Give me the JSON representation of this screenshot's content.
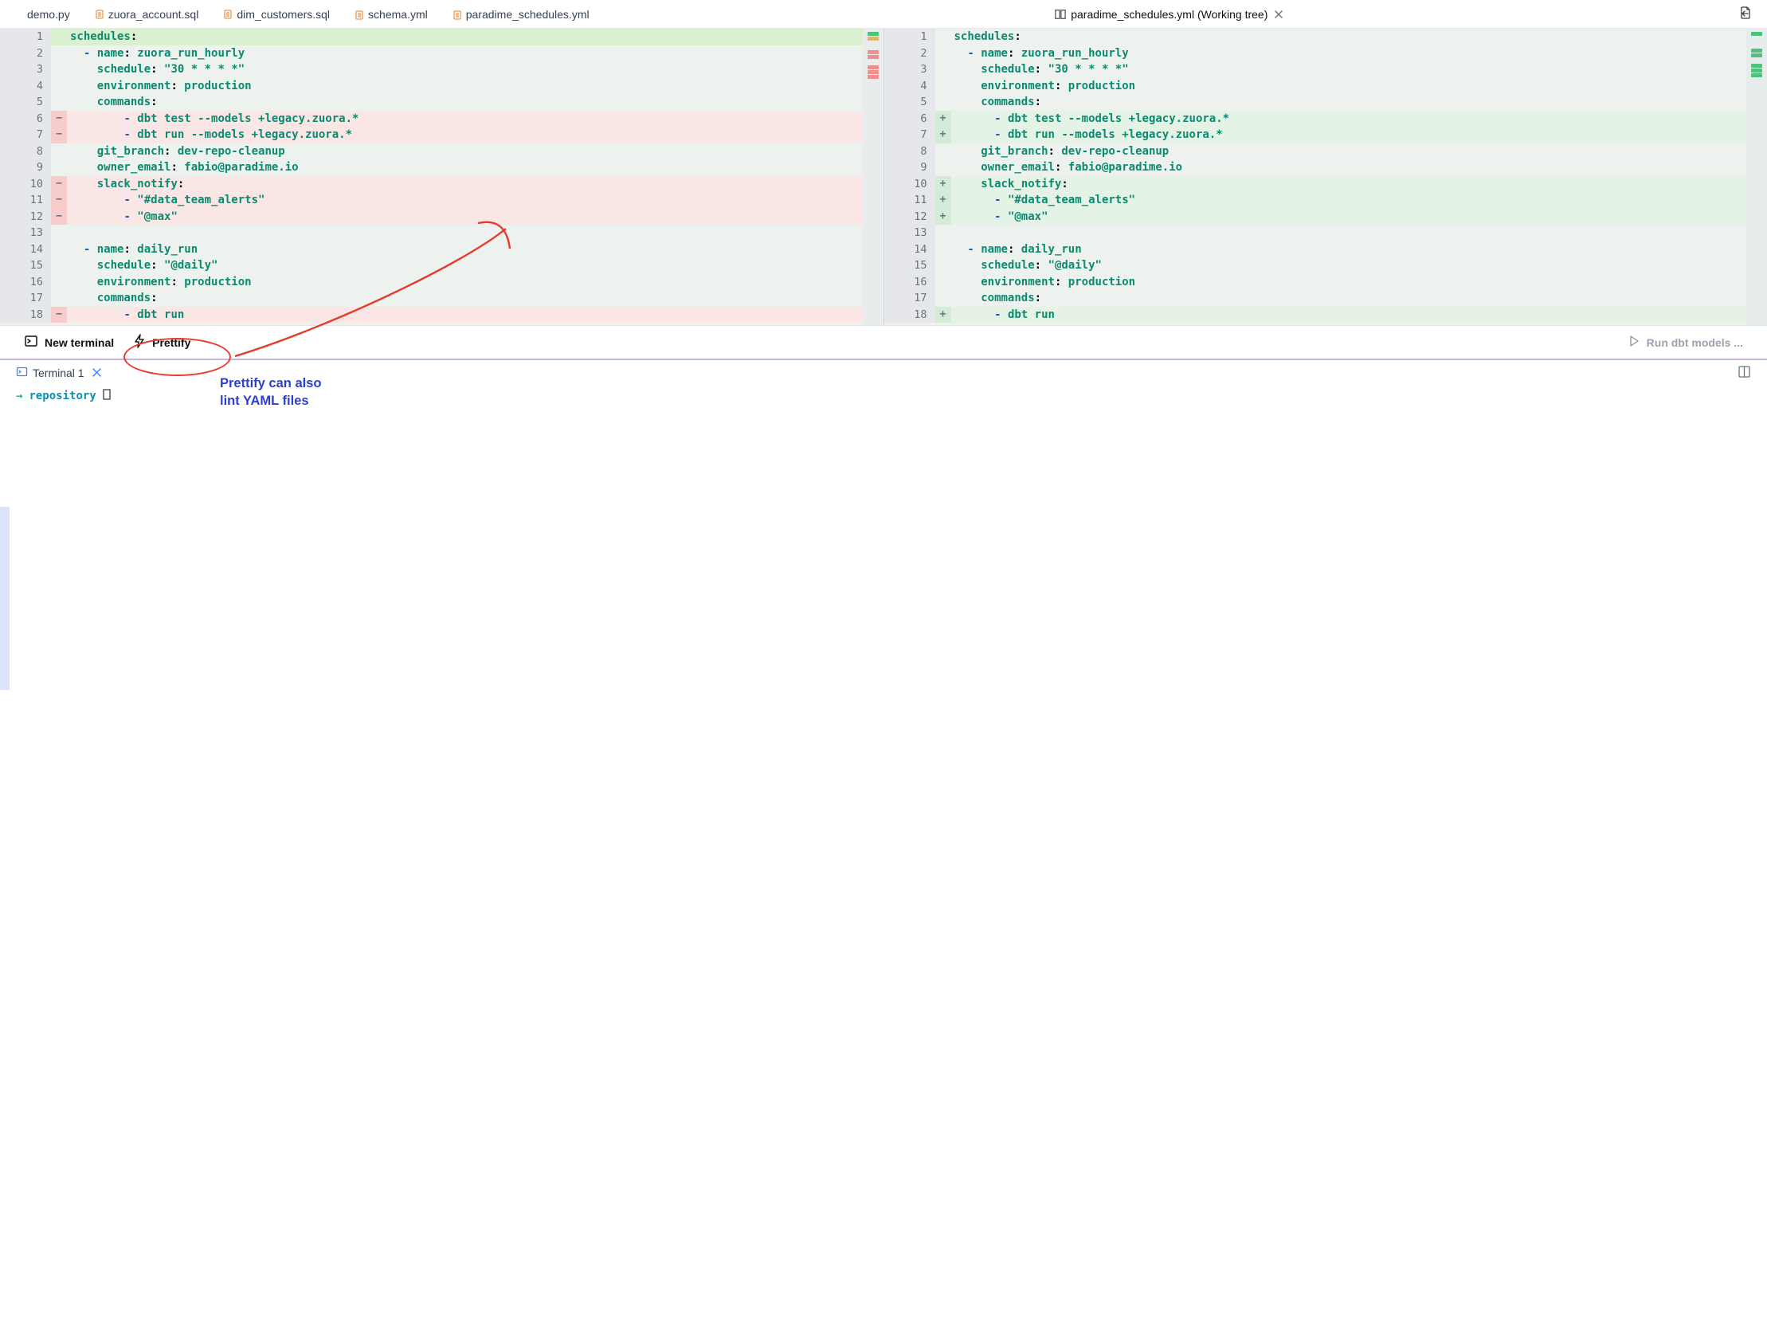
{
  "tabs": {
    "items": [
      {
        "label": "demo.py",
        "icon": null
      },
      {
        "label": "zuora_account.sql",
        "icon": "sql"
      },
      {
        "label": "dim_customers.sql",
        "icon": "sql"
      },
      {
        "label": "schema.yml",
        "icon": "yml"
      },
      {
        "label": "paradime_schedules.yml",
        "icon": "yml"
      },
      {
        "label": "paradime_schedules.yml (Working tree)",
        "icon": "split",
        "active": true,
        "closable": true
      }
    ]
  },
  "diff": {
    "left": [
      {
        "n": "1",
        "type": "hl-green",
        "code": "schedules:",
        "tokens": [
          [
            "schedules",
            "tk-key"
          ],
          [
            ":",
            ""
          ]
        ]
      },
      {
        "n": "2",
        "type": "neutral",
        "code": "  - name: zuora_run_hourly",
        "tokens": [
          [
            "  ",
            ""
          ],
          [
            "- ",
            "tk-dash"
          ],
          [
            "name",
            "tk-key"
          ],
          [
            ": ",
            ""
          ],
          [
            "zuora_run_hourly",
            "tk-val"
          ]
        ]
      },
      {
        "n": "3",
        "type": "neutral",
        "code": "    schedule: \"30 * * * *\"",
        "tokens": [
          [
            "    ",
            ""
          ],
          [
            "schedule",
            "tk-key"
          ],
          [
            ": ",
            ""
          ],
          [
            "\"30 * * * *\"",
            "tk-str"
          ]
        ]
      },
      {
        "n": "4",
        "type": "neutral",
        "code": "    environment: production",
        "tokens": [
          [
            "    ",
            ""
          ],
          [
            "environment",
            "tk-key"
          ],
          [
            ": ",
            ""
          ],
          [
            "production",
            "tk-val"
          ]
        ]
      },
      {
        "n": "5",
        "type": "neutral",
        "code": "    commands:",
        "tokens": [
          [
            "    ",
            ""
          ],
          [
            "commands",
            "tk-key"
          ],
          [
            ":",
            ""
          ]
        ]
      },
      {
        "n": "6",
        "type": "del",
        "sign": "−",
        "code": "        - dbt test --models +legacy.zuora.*",
        "tokens": [
          [
            "        ",
            ""
          ],
          [
            "- ",
            "tk-dash"
          ],
          [
            "dbt test --models +legacy.zuora.*",
            "tk-cmd"
          ]
        ]
      },
      {
        "n": "7",
        "type": "del",
        "sign": "−",
        "code": "        - dbt run --models +legacy.zuora.*",
        "tokens": [
          [
            "        ",
            ""
          ],
          [
            "- ",
            "tk-dash"
          ],
          [
            "dbt run --models +legacy.zuora.*",
            "tk-cmd"
          ]
        ]
      },
      {
        "n": "8",
        "type": "neutral",
        "code": "    git_branch: dev-repo-cleanup",
        "tokens": [
          [
            "    ",
            ""
          ],
          [
            "git_branch",
            "tk-key"
          ],
          [
            ": ",
            ""
          ],
          [
            "dev-repo-cleanup",
            "tk-val"
          ]
        ]
      },
      {
        "n": "9",
        "type": "neutral",
        "code": "    owner_email: fabio@paradime.io",
        "tokens": [
          [
            "    ",
            ""
          ],
          [
            "owner_email",
            "tk-key"
          ],
          [
            ": ",
            ""
          ],
          [
            "fabio@paradime.io",
            "tk-val"
          ]
        ]
      },
      {
        "n": "10",
        "type": "del",
        "sign": "−",
        "code": "    slack_notify:",
        "tokens": [
          [
            "    ",
            ""
          ],
          [
            "slack_notify",
            "tk-key"
          ],
          [
            ":",
            ""
          ]
        ]
      },
      {
        "n": "11",
        "type": "del",
        "sign": "−",
        "code": "        - \"#data_team_alerts\"",
        "tokens": [
          [
            "        ",
            ""
          ],
          [
            "- ",
            "tk-dash"
          ],
          [
            "\"#data_team_alerts\"",
            "tk-str"
          ]
        ]
      },
      {
        "n": "12",
        "type": "del",
        "sign": "−",
        "code": "        - \"@max\"",
        "tokens": [
          [
            "        ",
            ""
          ],
          [
            "- ",
            "tk-dash"
          ],
          [
            "\"@max\"",
            "tk-str"
          ]
        ]
      },
      {
        "n": "13",
        "type": "neutral",
        "code": "",
        "tokens": []
      },
      {
        "n": "14",
        "type": "neutral",
        "code": "  - name: daily_run",
        "tokens": [
          [
            "  ",
            ""
          ],
          [
            "- ",
            "tk-dash"
          ],
          [
            "name",
            "tk-key"
          ],
          [
            ": ",
            ""
          ],
          [
            "daily_run",
            "tk-val"
          ]
        ]
      },
      {
        "n": "15",
        "type": "neutral",
        "code": "    schedule: \"@daily\"",
        "tokens": [
          [
            "    ",
            ""
          ],
          [
            "schedule",
            "tk-key"
          ],
          [
            ": ",
            ""
          ],
          [
            "\"@daily\"",
            "tk-str"
          ]
        ]
      },
      {
        "n": "16",
        "type": "neutral",
        "code": "    environment: production",
        "tokens": [
          [
            "    ",
            ""
          ],
          [
            "environment",
            "tk-key"
          ],
          [
            ": ",
            ""
          ],
          [
            "production",
            "tk-val"
          ]
        ]
      },
      {
        "n": "17",
        "type": "neutral",
        "code": "    commands:",
        "tokens": [
          [
            "    ",
            ""
          ],
          [
            "commands",
            "tk-key"
          ],
          [
            ":",
            ""
          ]
        ]
      },
      {
        "n": "18",
        "type": "del",
        "sign": "−",
        "code": "        - dbt run",
        "tokens": [
          [
            "        ",
            ""
          ],
          [
            "- ",
            "tk-dash"
          ],
          [
            "dbt run",
            "tk-cmd"
          ]
        ]
      }
    ],
    "right": [
      {
        "n": "1",
        "type": "neutral",
        "code": "schedules:",
        "tokens": [
          [
            "schedules",
            "tk-key"
          ],
          [
            ":",
            ""
          ]
        ]
      },
      {
        "n": "2",
        "type": "neutral",
        "code": "  - name: zuora_run_hourly",
        "tokens": [
          [
            "  ",
            ""
          ],
          [
            "- ",
            "tk-dash"
          ],
          [
            "name",
            "tk-key"
          ],
          [
            ": ",
            ""
          ],
          [
            "zuora_run_hourly",
            "tk-val"
          ]
        ]
      },
      {
        "n": "3",
        "type": "neutral",
        "code": "    schedule: \"30 * * * *\"",
        "tokens": [
          [
            "    ",
            ""
          ],
          [
            "schedule",
            "tk-key"
          ],
          [
            ": ",
            ""
          ],
          [
            "\"30 * * * *\"",
            "tk-str"
          ]
        ]
      },
      {
        "n": "4",
        "type": "neutral",
        "code": "    environment: production",
        "tokens": [
          [
            "    ",
            ""
          ],
          [
            "environment",
            "tk-key"
          ],
          [
            ": ",
            ""
          ],
          [
            "production",
            "tk-val"
          ]
        ]
      },
      {
        "n": "5",
        "type": "neutral",
        "code": "    commands:",
        "tokens": [
          [
            "    ",
            ""
          ],
          [
            "commands",
            "tk-key"
          ],
          [
            ":",
            ""
          ]
        ]
      },
      {
        "n": "6",
        "type": "add",
        "sign": "+",
        "arrow": true,
        "code": "      - dbt test --models +legacy.zuora.*",
        "tokens": [
          [
            "      ",
            ""
          ],
          [
            "- ",
            "tk-dash"
          ],
          [
            "dbt test --models +legacy.zuora.*",
            "tk-cmd"
          ]
        ]
      },
      {
        "n": "7",
        "type": "add",
        "sign": "+",
        "code": "      - dbt run --models +legacy.zuora.*",
        "tokens": [
          [
            "      ",
            ""
          ],
          [
            "- ",
            "tk-dash"
          ],
          [
            "dbt run --models +legacy.zuora.*",
            "tk-cmd"
          ]
        ]
      },
      {
        "n": "8",
        "type": "neutral",
        "code": "    git_branch: dev-repo-cleanup",
        "tokens": [
          [
            "    ",
            ""
          ],
          [
            "git_branch",
            "tk-key"
          ],
          [
            ": ",
            ""
          ],
          [
            "dev-repo-cleanup",
            "tk-val"
          ]
        ]
      },
      {
        "n": "9",
        "type": "neutral",
        "code": "    owner_email: fabio@paradime.io",
        "tokens": [
          [
            "    ",
            ""
          ],
          [
            "owner_email",
            "tk-key"
          ],
          [
            ": ",
            ""
          ],
          [
            "fabio@paradime.io",
            "tk-val"
          ]
        ]
      },
      {
        "n": "10",
        "type": "add",
        "sign": "+",
        "arrow": true,
        "code": "    slack_notify:",
        "tokens": [
          [
            "    ",
            ""
          ],
          [
            "slack_notify",
            "tk-key"
          ],
          [
            ":",
            ""
          ]
        ]
      },
      {
        "n": "11",
        "type": "add",
        "sign": "+",
        "code": "      - \"#data_team_alerts\"",
        "tokens": [
          [
            "      ",
            ""
          ],
          [
            "- ",
            "tk-dash"
          ],
          [
            "\"#data_team_alerts\"",
            "tk-str"
          ]
        ]
      },
      {
        "n": "12",
        "type": "add",
        "sign": "+",
        "code": "      - \"@max\"",
        "tokens": [
          [
            "      ",
            ""
          ],
          [
            "- ",
            "tk-dash"
          ],
          [
            "\"@max\"",
            "tk-str"
          ]
        ]
      },
      {
        "n": "13",
        "type": "neutral",
        "code": "",
        "tokens": []
      },
      {
        "n": "14",
        "type": "neutral",
        "code": "  - name: daily_run",
        "tokens": [
          [
            "  ",
            ""
          ],
          [
            "- ",
            "tk-dash"
          ],
          [
            "name",
            "tk-key"
          ],
          [
            ": ",
            ""
          ],
          [
            "daily_run",
            "tk-val"
          ]
        ]
      },
      {
        "n": "15",
        "type": "neutral",
        "code": "    schedule: \"@daily\"",
        "tokens": [
          [
            "    ",
            ""
          ],
          [
            "schedule",
            "tk-key"
          ],
          [
            ": ",
            ""
          ],
          [
            "\"@daily\"",
            "tk-str"
          ]
        ]
      },
      {
        "n": "16",
        "type": "neutral",
        "code": "    environment: production",
        "tokens": [
          [
            "    ",
            ""
          ],
          [
            "environment",
            "tk-key"
          ],
          [
            ": ",
            ""
          ],
          [
            "production",
            "tk-val"
          ]
        ]
      },
      {
        "n": "17",
        "type": "neutral",
        "code": "    commands:",
        "tokens": [
          [
            "    ",
            ""
          ],
          [
            "commands",
            "tk-key"
          ],
          [
            ":",
            ""
          ]
        ]
      },
      {
        "n": "18",
        "type": "add",
        "sign": "+",
        "arrow": true,
        "code": "      - dbt run",
        "tokens": [
          [
            "      ",
            ""
          ],
          [
            "- ",
            "tk-dash"
          ],
          [
            "dbt run",
            "tk-cmd"
          ]
        ]
      }
    ]
  },
  "toolbar": {
    "new_terminal": "New terminal",
    "prettify": "Prettify",
    "run_models": "Run dbt models ..."
  },
  "terminal": {
    "tab_label": "Terminal 1",
    "prompt_arrow": "→",
    "prompt_path": "repository",
    "cursor": "▯"
  },
  "annotation": {
    "text_line1": "Prettify can also",
    "text_line2": "lint YAML files"
  }
}
